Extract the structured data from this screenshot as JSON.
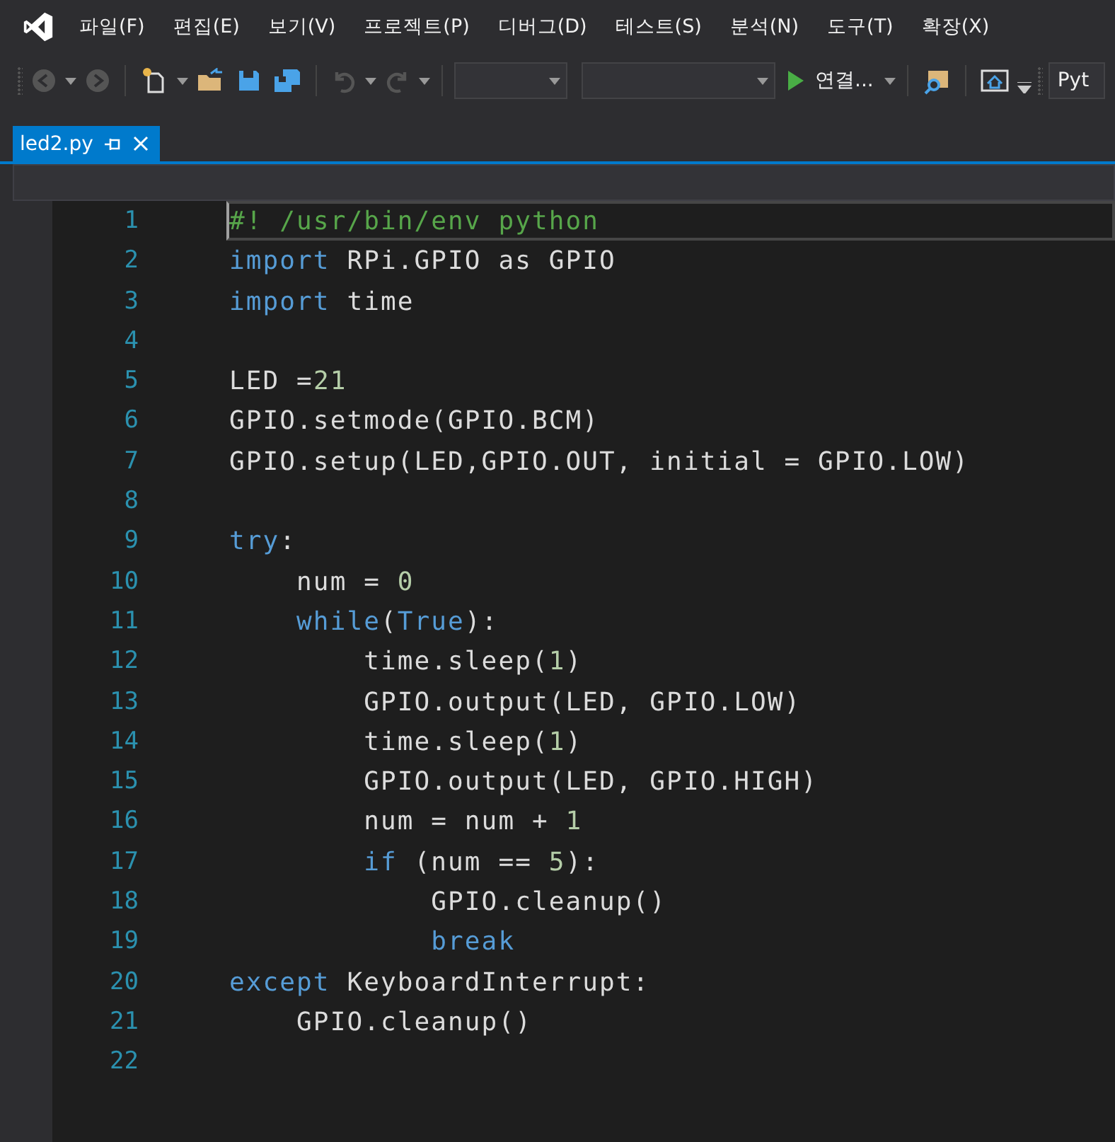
{
  "menu": [
    "파일(F)",
    "편집(E)",
    "보기(V)",
    "프로젝트(P)",
    "디버그(D)",
    "테스트(S)",
    "분석(N)",
    "도구(T)",
    "확장(X)"
  ],
  "toolbar": {
    "run_label": "연결...",
    "combo_text": "Pyt"
  },
  "tabs": [
    {
      "label": "led2.py",
      "selected": true
    }
  ],
  "lines": [
    {
      "number": "1",
      "current": true,
      "tokens": [
        {
          "kind": "comment",
          "text": "#! /usr/bin/env python"
        }
      ]
    },
    {
      "number": "2",
      "current": false,
      "tokens": [
        {
          "kind": "kw",
          "text": "import"
        },
        {
          "kind": "text",
          "text": " RPi.GPIO as GPIO"
        }
      ]
    },
    {
      "number": "3",
      "current": false,
      "tokens": [
        {
          "kind": "kw",
          "text": "import"
        },
        {
          "kind": "text",
          "text": " time"
        }
      ]
    },
    {
      "number": "4",
      "current": false
    },
    {
      "number": "5",
      "current": false,
      "tokens": [
        {
          "kind": "text",
          "text": "LED ="
        },
        {
          "kind": "num",
          "text": "21"
        }
      ]
    },
    {
      "number": "6",
      "current": false,
      "tokens": [
        {
          "kind": "text",
          "text": "GPIO.setmode(GPIO.BCM)"
        }
      ]
    },
    {
      "number": "7",
      "current": false,
      "tokens": [
        {
          "kind": "text",
          "text": "GPIO.setup(LED,GPIO.OUT, initial = GPIO.LOW)"
        }
      ]
    },
    {
      "number": "8",
      "current": false
    },
    {
      "number": "9",
      "current": false,
      "tokens": [
        {
          "kind": "kw",
          "text": "try"
        },
        {
          "kind": "text",
          "text": ":"
        }
      ]
    },
    {
      "number": "10",
      "current": false,
      "tokens": [
        {
          "kind": "text",
          "text": "    num = "
        },
        {
          "kind": "num",
          "text": "0"
        }
      ]
    },
    {
      "number": "11",
      "current": false,
      "tokens": [
        {
          "kind": "kw",
          "text": "    while"
        },
        {
          "kind": "text",
          "text": "("
        },
        {
          "kind": "kw",
          "text": "True"
        },
        {
          "kind": "text",
          "text": "):"
        }
      ]
    },
    {
      "number": "12",
      "current": false,
      "tokens": [
        {
          "kind": "text",
          "text": "        time.sleep("
        },
        {
          "kind": "num",
          "text": "1"
        },
        {
          "kind": "text",
          "text": ")"
        }
      ]
    },
    {
      "number": "13",
      "current": false,
      "tokens": [
        {
          "kind": "text",
          "text": "        GPIO.output(LED, GPIO.LOW)"
        }
      ]
    },
    {
      "number": "14",
      "current": false,
      "tokens": [
        {
          "kind": "text",
          "text": "        time.sleep("
        },
        {
          "kind": "num",
          "text": "1"
        },
        {
          "kind": "text",
          "text": ")"
        }
      ]
    },
    {
      "number": "15",
      "current": false,
      "tokens": [
        {
          "kind": "text",
          "text": "        GPIO.output(LED, GPIO.HIGH)"
        }
      ]
    },
    {
      "number": "16",
      "current": false,
      "tokens": [
        {
          "kind": "text",
          "text": "        num = num + "
        },
        {
          "kind": "num",
          "text": "1"
        }
      ]
    },
    {
      "number": "17",
      "current": false,
      "tokens": [
        {
          "kind": "kw",
          "text": "        if"
        },
        {
          "kind": "text",
          "text": " (num == "
        },
        {
          "kind": "num",
          "text": "5"
        },
        {
          "kind": "text",
          "text": "):"
        }
      ]
    },
    {
      "number": "18",
      "current": false,
      "tokens": [
        {
          "kind": "text",
          "text": "            GPIO.cleanup()"
        }
      ]
    },
    {
      "number": "19",
      "current": false,
      "tokens": [
        {
          "kind": "kw",
          "text": "            break"
        }
      ]
    },
    {
      "number": "20",
      "current": false,
      "tokens": [
        {
          "kind": "kw",
          "text": "except"
        },
        {
          "kind": "text",
          "text": " KeyboardInterrupt:"
        }
      ]
    },
    {
      "number": "21",
      "current": false,
      "tokens": [
        {
          "kind": "text",
          "text": "    GPIO.cleanup()"
        }
      ]
    },
    {
      "number": "22",
      "current": false
    }
  ]
}
